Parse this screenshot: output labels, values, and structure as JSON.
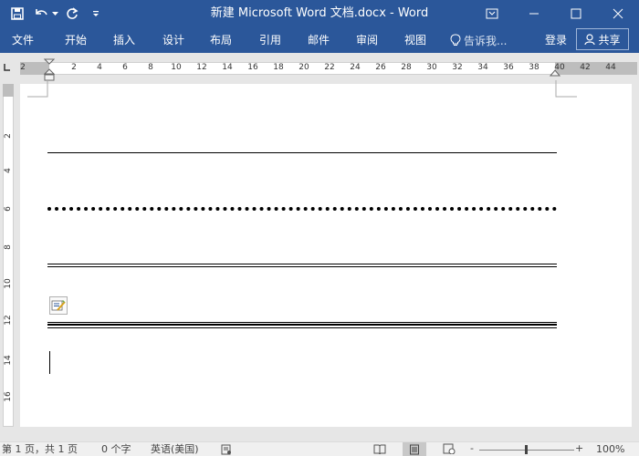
{
  "window": {
    "title": "新建 Microsoft Word 文档.docx - Word",
    "qat_icons": [
      "save-icon",
      "undo-icon",
      "redo-icon",
      "customize-qat-icon"
    ],
    "window_icons": [
      "ribbon-display-icon",
      "minimize-icon",
      "maximize-icon",
      "close-icon"
    ]
  },
  "menu": {
    "tabs": [
      "文件",
      "开始",
      "插入",
      "设计",
      "布局",
      "引用",
      "邮件",
      "审阅",
      "视图"
    ],
    "tell_me": "告诉我...",
    "login": "登录",
    "share": "共享"
  },
  "ruler": {
    "h_labels": [
      "2",
      "2",
      "4",
      "6",
      "8",
      "10",
      "12",
      "14",
      "16",
      "18",
      "20",
      "22",
      "24",
      "26",
      "28",
      "30",
      "32",
      "34",
      "36",
      "38",
      "40",
      "42",
      "44"
    ],
    "v_labels": [
      "2",
      "4",
      "6",
      "8",
      "10",
      "12",
      "14",
      "16"
    ]
  },
  "document": {
    "line_styles": [
      "single",
      "dotted",
      "double",
      "triple"
    ]
  },
  "status": {
    "page": "第 1 页，共 1 页",
    "words": "0 个字",
    "language": "英语(美国)",
    "zoom": "100%",
    "zoom_minus": "-",
    "zoom_plus": "+"
  },
  "colors": {
    "accent": "#2b579a"
  }
}
